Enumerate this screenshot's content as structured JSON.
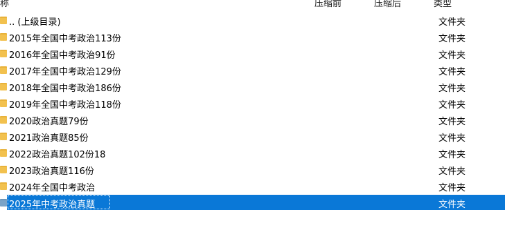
{
  "columns": {
    "name": "称",
    "before": "压缩前",
    "after": "压缩后",
    "type": "类型"
  },
  "rows": [
    {
      "name": ".. (上级目录)",
      "type": "文件夹",
      "icon": "folder-icon",
      "selected": false
    },
    {
      "name": "2015年全国中考政治113份",
      "type": "文件夹",
      "icon": "folder-icon",
      "selected": false
    },
    {
      "name": "2016年全国中考政治91份",
      "type": "文件夹",
      "icon": "folder-icon",
      "selected": false
    },
    {
      "name": "2017年全国中考政治129份",
      "type": "文件夹",
      "icon": "folder-icon",
      "selected": false
    },
    {
      "name": "2018年全国中考政治186份",
      "type": "文件夹",
      "icon": "folder-icon",
      "selected": false
    },
    {
      "name": "2019年全国中考政治118份",
      "type": "文件夹",
      "icon": "folder-icon",
      "selected": false
    },
    {
      "name": "2020政治真题79份",
      "type": "文件夹",
      "icon": "folder-icon",
      "selected": false
    },
    {
      "name": "2021政治真题85份",
      "type": "文件夹",
      "icon": "folder-icon",
      "selected": false
    },
    {
      "name": "2022政治真题102份18",
      "type": "文件夹",
      "icon": "folder-icon",
      "selected": false
    },
    {
      "name": "2023政治真题116份",
      "type": "文件夹",
      "icon": "folder-icon",
      "selected": false
    },
    {
      "name": "2024年全国中考政治",
      "type": "文件夹",
      "icon": "folder-icon",
      "selected": false
    },
    {
      "name": "2025年中考政治真题",
      "type": "文件夹",
      "icon": "folder-icon",
      "selected": true
    }
  ],
  "colors": {
    "selection": "#0a78d7",
    "folder": "#f2c14e"
  }
}
